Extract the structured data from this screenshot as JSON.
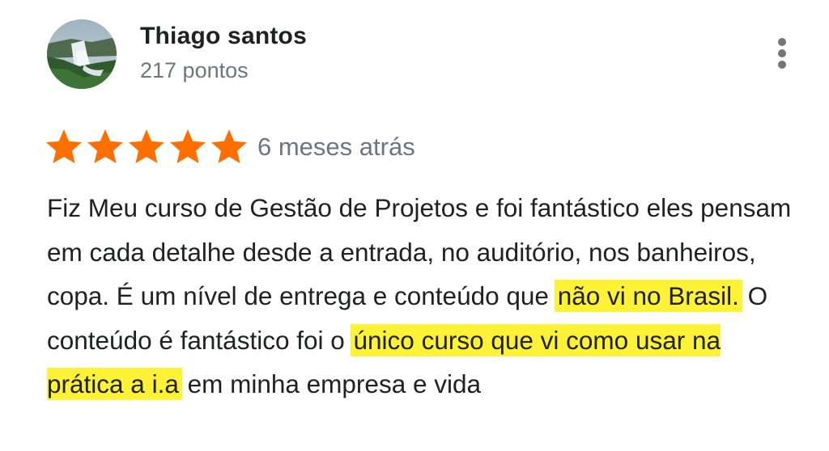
{
  "review": {
    "author_name": "Thiago santos",
    "author_points": "217 pontos",
    "rating": 5,
    "rating_max": 5,
    "star_color": "#ff6f00",
    "date": "6 meses atrás",
    "avatar_icon": "waterfall-photo",
    "menu_icon": "more-vert-icon",
    "highlight_color": "#fdf236",
    "text_segments": [
      {
        "text": "Fiz Meu curso de Gestão de Projetos e foi fantástico eles pensam em cada detalhe desde a entrada, no auditório, nos banheiros, copa. É um nível de entrega e conteúdo que ",
        "highlight": false
      },
      {
        "text": "não vi no Brasil.",
        "highlight": true
      },
      {
        "text": " O conteúdo é fantástico foi o ",
        "highlight": false
      },
      {
        "text": "único curso que vi como usar na prática a i.a",
        "highlight": true
      },
      {
        "text": " em minha empresa e vida",
        "highlight": false
      }
    ]
  }
}
